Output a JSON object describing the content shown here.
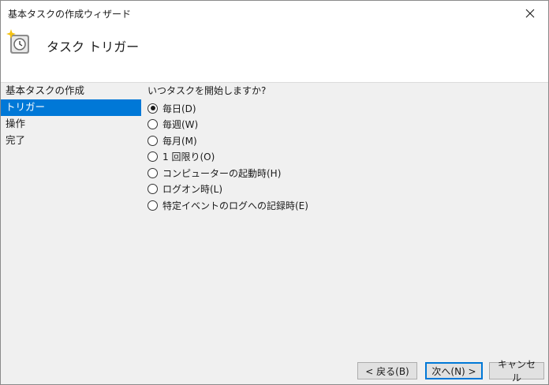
{
  "window": {
    "title": "基本タスクの作成ウィザード",
    "close_glyph": "✕"
  },
  "header": {
    "heading": "タスク トリガー",
    "icon": "clock-task-icon"
  },
  "steps": [
    {
      "label": "基本タスクの作成",
      "active": false
    },
    {
      "label": "トリガー",
      "active": true
    },
    {
      "label": "操作",
      "active": false
    },
    {
      "label": "完了",
      "active": false
    }
  ],
  "content": {
    "question": "いつタスクを開始しますか?",
    "options": [
      {
        "label": "毎日(D)",
        "checked": true
      },
      {
        "label": "毎週(W)",
        "checked": false
      },
      {
        "label": "毎月(M)",
        "checked": false
      },
      {
        "label": "1 回限り(O)",
        "checked": false
      },
      {
        "label": "コンピューターの起動時(H)",
        "checked": false
      },
      {
        "label": "ログオン時(L)",
        "checked": false
      },
      {
        "label": "特定イベントのログへの記録時(E)",
        "checked": false
      }
    ]
  },
  "buttons": {
    "back": "< 戻る(B)",
    "next": "次へ(N) >",
    "cancel": "キャンセル"
  },
  "colors": {
    "accent": "#0078d7",
    "panel": "#f0f0f0",
    "header_bg": "#ffffff"
  }
}
